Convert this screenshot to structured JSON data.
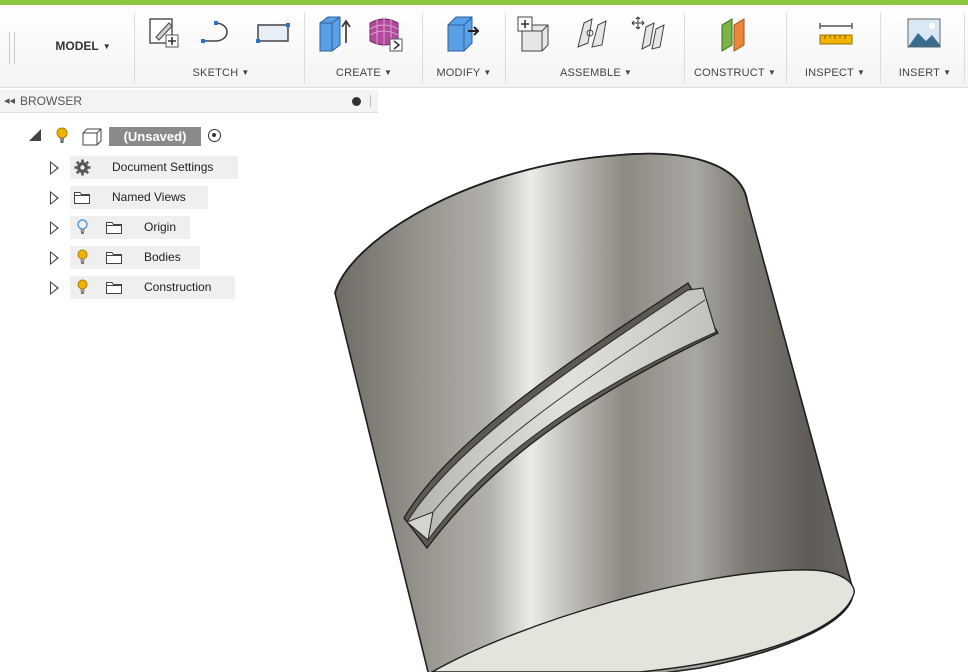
{
  "toolbar": {
    "workspace_label": "MODEL",
    "groups": [
      {
        "label": "SKETCH",
        "icons": [
          "create-sketch-icon",
          "spline-icon",
          "rectangle-icon"
        ]
      },
      {
        "label": "CREATE",
        "icons": [
          "extrude-icon",
          "form-icon"
        ]
      },
      {
        "label": "MODIFY",
        "icons": [
          "press-pull-icon"
        ]
      },
      {
        "label": "ASSEMBLE",
        "icons": [
          "new-component-icon",
          "joint-icon",
          "as-built-joint-icon"
        ]
      },
      {
        "label": "CONSTRUCT",
        "icons": [
          "offset-plane-icon"
        ]
      },
      {
        "label": "INSPECT",
        "icons": [
          "measure-icon"
        ]
      },
      {
        "label": "INSERT",
        "icons": [
          "insert-image-icon"
        ]
      }
    ]
  },
  "browser": {
    "title": "BROWSER",
    "root": {
      "label": "(Unsaved)"
    },
    "items": [
      {
        "label": "Document Settings",
        "icon": "gear-icon",
        "visibility": false
      },
      {
        "label": "Named Views",
        "icon": "folder-icon",
        "visibility": false
      },
      {
        "label": "Origin",
        "icon": "folder-icon",
        "visibility": true,
        "bulb_color": "#5b9bd5"
      },
      {
        "label": "Bodies",
        "icon": "folder-icon",
        "visibility": true,
        "bulb_color": "#f0b400"
      },
      {
        "label": "Construction",
        "icon": "folder-icon",
        "visibility": true,
        "bulb_color": "#f0b400"
      }
    ]
  },
  "colors": {
    "accent": "#8dc63f",
    "bulb_on": "#f0b400",
    "bulb_origin": "#5b9bd5",
    "body_metal": "#8a8780"
  }
}
